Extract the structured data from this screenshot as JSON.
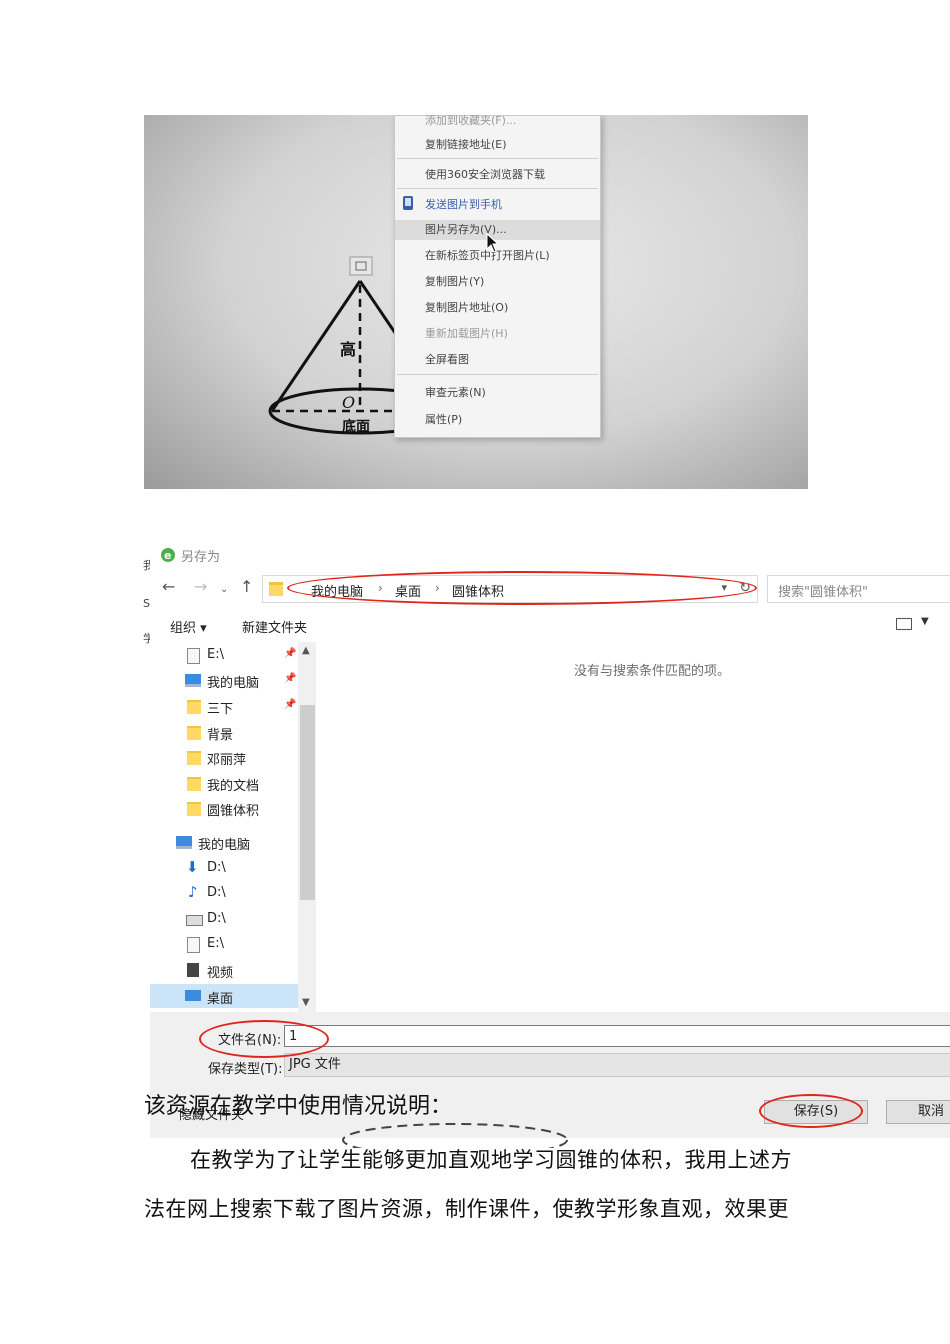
{
  "context_menu": {
    "items": [
      {
        "label": "添加到收藏夹(F)...",
        "style": "dim"
      },
      {
        "label": "复制链接地址(E)",
        "style": "normal"
      },
      {
        "label": "使用360安全浏览器下载",
        "style": "normal"
      },
      {
        "label": "发送图片到手机",
        "style": "blue"
      },
      {
        "label": "图片另存为(V)...",
        "style": "highlight"
      },
      {
        "label": "在新标签页中打开图片(L)",
        "style": "normal"
      },
      {
        "label": "复制图片(Y)",
        "style": "normal"
      },
      {
        "label": "复制图片地址(O)",
        "style": "normal"
      },
      {
        "label": "重新加载图片(H)",
        "style": "dim"
      },
      {
        "label": "全屏看图",
        "style": "normal"
      },
      {
        "label": "审查元素(N)",
        "style": "normal"
      },
      {
        "label": "属性(P)",
        "style": "normal"
      }
    ]
  },
  "cone_figure": {
    "height_label": "高",
    "center_label": "O",
    "base_label": "底面"
  },
  "dialog": {
    "title": "另存为",
    "breadcrumbs": [
      "我的电脑",
      "桌面",
      "圆锥体积"
    ],
    "search_placeholder": "搜索\"圆锥体积\"",
    "toolbar": {
      "organize": "组织 ▾",
      "new_folder": "新建文件夹"
    },
    "nav_items": [
      {
        "label": "E:\\",
        "icon": "drive-icon",
        "pinned": true
      },
      {
        "label": "我的电脑",
        "icon": "computer-icon",
        "pinned": true
      },
      {
        "label": "三下",
        "icon": "folder-icon",
        "pinned": true
      },
      {
        "label": "背景",
        "icon": "folder-icon",
        "pinned": false
      },
      {
        "label": "邓丽萍",
        "icon": "folder-icon",
        "pinned": false
      },
      {
        "label": "我的文档",
        "icon": "folder-icon",
        "pinned": false
      },
      {
        "label": "圆锥体积",
        "icon": "folder-icon",
        "pinned": false
      },
      {
        "label": "我的电脑",
        "icon": "computer-icon",
        "pinned": false
      },
      {
        "label": "D:\\",
        "icon": "download-icon",
        "pinned": false
      },
      {
        "label": "D:\\",
        "icon": "music-icon",
        "pinned": false
      },
      {
        "label": "D:\\",
        "icon": "disk-icon",
        "pinned": false
      },
      {
        "label": "E:\\",
        "icon": "drive-icon",
        "pinned": false
      },
      {
        "label": "视频",
        "icon": "video-icon",
        "pinned": false
      },
      {
        "label": "桌面",
        "icon": "desktop-icon",
        "pinned": false,
        "selected": true
      }
    ],
    "empty_message": "没有与搜索条件匹配的项。",
    "filename_label": "文件名(N):",
    "filename_value": "1",
    "filetype_label": "保存类型(T):",
    "filetype_value": "JPG 文件",
    "hide_folders": "隐藏文件夹",
    "save_button": "保存(S)",
    "cancel_button": "取消",
    "left_strip_chars": [
      "我",
      "S",
      "学"
    ]
  },
  "document": {
    "heading": "该资源在教学中使用情况说明：",
    "para_line1": "在教学为了让学生能够更加直观地学习圆锥的体积，我用上述方",
    "para_line2": "法在网上搜索下载了图片资源，制作课件，使教学形象直观，效果更"
  },
  "colors": {
    "annotation_red": "#e0251b",
    "selection_blue": "#cce4f7",
    "menu_blue": "#3a5ea8"
  }
}
